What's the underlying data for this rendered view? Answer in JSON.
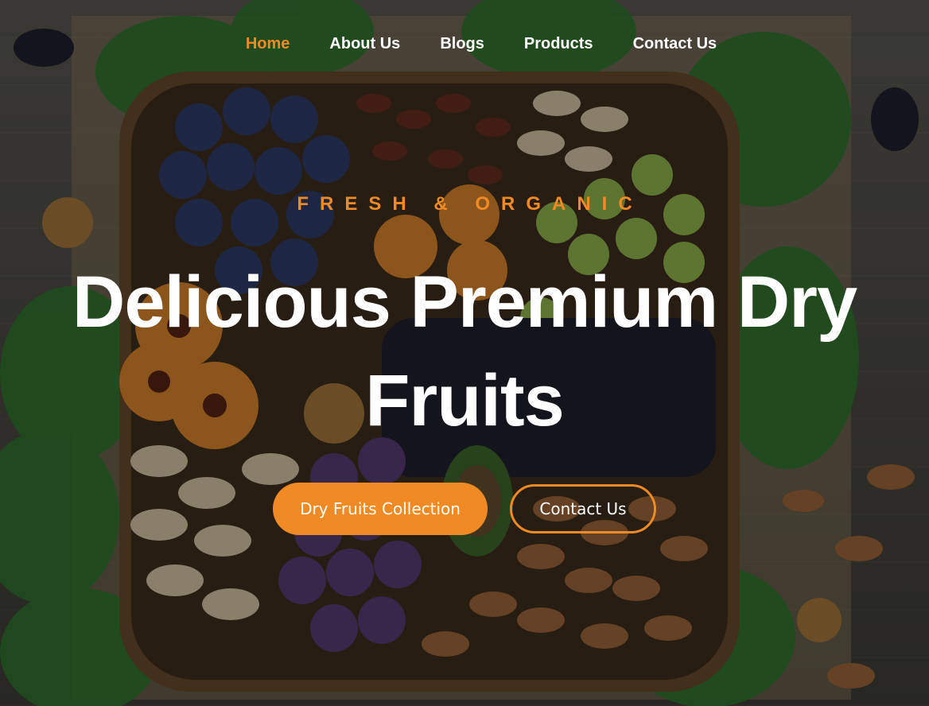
{
  "nav": {
    "items": [
      {
        "label": "Home",
        "active": true
      },
      {
        "label": "About Us",
        "active": false
      },
      {
        "label": "Blogs",
        "active": false
      },
      {
        "label": "Products",
        "active": false
      },
      {
        "label": "Contact Us",
        "active": false
      }
    ]
  },
  "hero": {
    "tagline": "FRESH & ORGANIC",
    "headline_line1": "Delicious Premium Dry",
    "headline_line2": "Fruits",
    "primary_button": "Dry Fruits Collection",
    "secondary_button": "Contact Us"
  },
  "colors": {
    "accent": "#f08a24",
    "text": "#ffffff"
  }
}
